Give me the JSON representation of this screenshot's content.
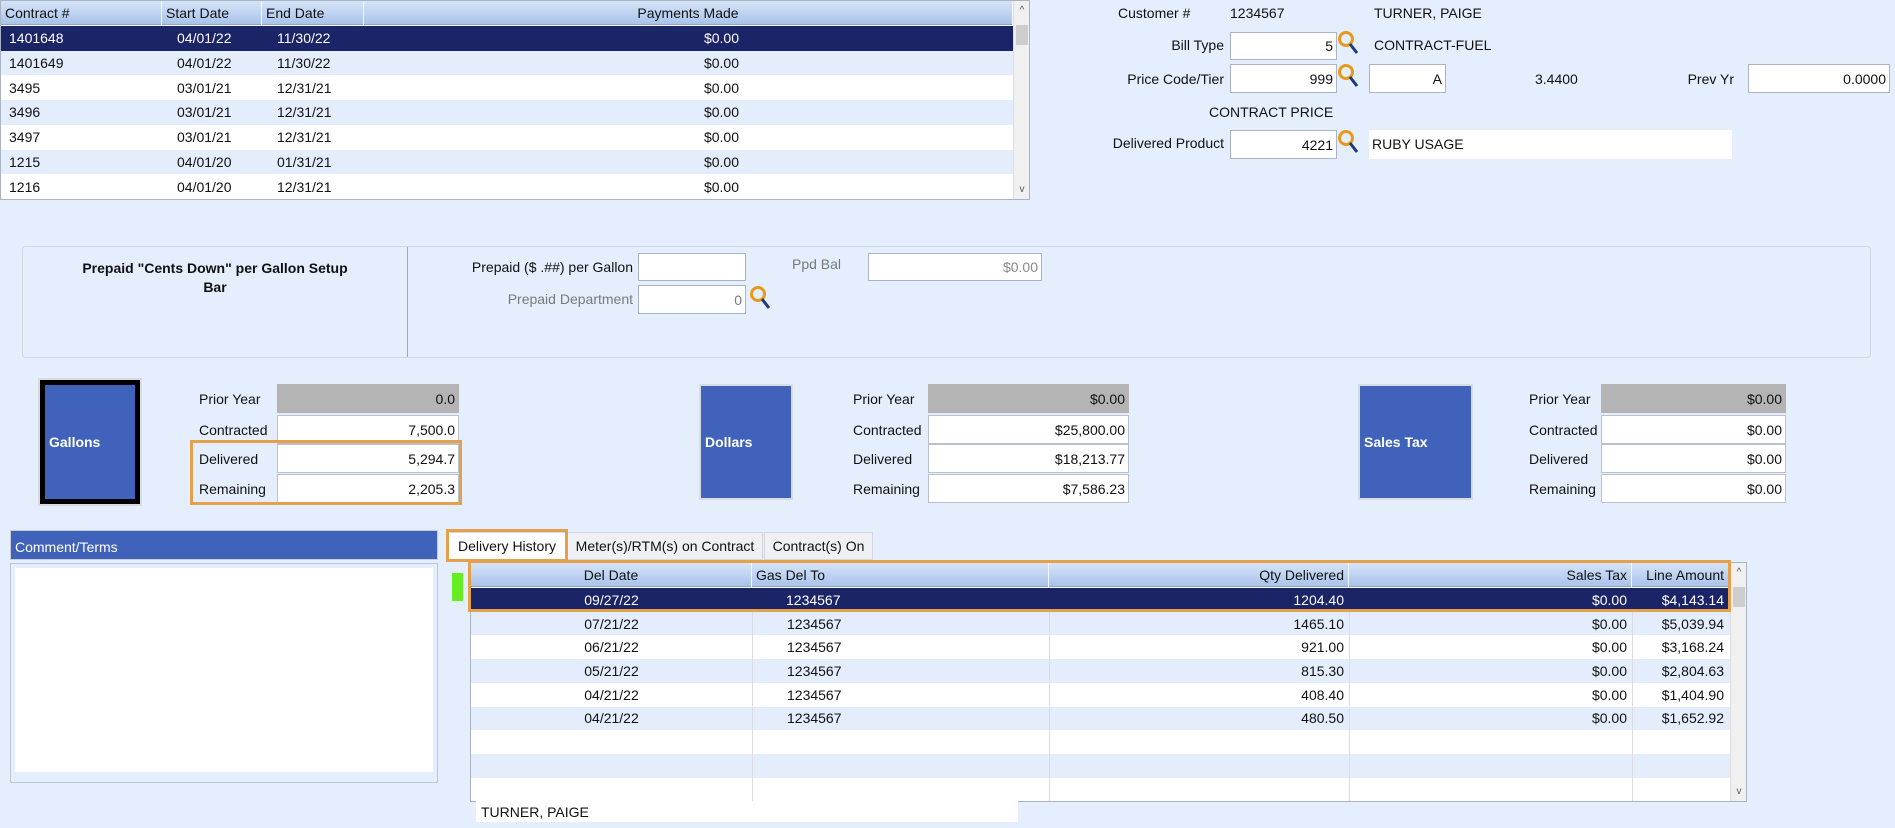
{
  "contracts": {
    "columns": [
      "Contract #",
      "Start Date",
      "End Date",
      "Payments Made"
    ],
    "rows": [
      [
        "1401648",
        "04/01/22",
        "11/30/22",
        "$0.00"
      ],
      [
        "1401649",
        "04/01/22",
        "11/30/22",
        "$0.00"
      ],
      [
        "3495",
        "03/01/21",
        "12/31/21",
        "$0.00"
      ],
      [
        "3496",
        "03/01/21",
        "12/31/21",
        "$0.00"
      ],
      [
        "3497",
        "03/01/21",
        "12/31/21",
        "$0.00"
      ],
      [
        "1215",
        "04/01/20",
        "01/31/21",
        "$0.00"
      ],
      [
        "1216",
        "04/01/20",
        "12/31/21",
        "$0.00"
      ]
    ],
    "selected_index": 0
  },
  "customer": {
    "customer_label": "Customer #",
    "customer_number": "1234567",
    "customer_name": "TURNER, PAIGE",
    "bill_type_label": "Bill Type",
    "bill_type_value": "5",
    "bill_type_desc": "CONTRACT-FUEL",
    "price_code_label": "Price Code/Tier",
    "price_code_value": "999",
    "tier_value": "A",
    "price": "3.4400",
    "prev_yr_label": "Prev Yr",
    "prev_yr_value": "0.0000",
    "price_desc": "CONTRACT PRICE",
    "delivered_product_label": "Delivered Product",
    "delivered_product_value": "4221",
    "delivered_product_desc": "RUBY USAGE"
  },
  "prepaid": {
    "title_line1": "Prepaid \"Cents Down\" per Gallon Setup",
    "title_line2": "Bar",
    "per_gallon_label": "Prepaid ($ .##) per Gallon",
    "per_gallon_value": "",
    "department_label": "Prepaid Department",
    "department_value": "0",
    "ppd_bal_label": "Ppd Bal",
    "ppd_bal_value": "$0.00"
  },
  "stats": {
    "row_labels": [
      "Prior Year",
      "Contracted",
      "Delivered",
      "Remaining"
    ],
    "gallons": {
      "button": "Gallons",
      "values": [
        "0.0",
        "7,500.0",
        "5,294.7",
        "2,205.3"
      ]
    },
    "dollars": {
      "button": "Dollars",
      "values": [
        "$0.00",
        "$25,800.00",
        "$18,213.77",
        "$7,586.23"
      ]
    },
    "sales_tax": {
      "button": "Sales Tax",
      "values": [
        "$0.00",
        "$0.00",
        "$0.00",
        "$0.00"
      ]
    }
  },
  "comments": {
    "header": "Comment/Terms",
    "text": ""
  },
  "tabs": [
    "Delivery History",
    "Meter(s)/RTM(s) on Contract",
    "Contract(s) On"
  ],
  "delivery": {
    "columns": [
      "Del Date",
      "Gas Del To",
      "Qty Delivered",
      "Sales Tax",
      "Line Amount"
    ],
    "rows": [
      [
        "09/27/22",
        "1234567",
        "1204.40",
        "$0.00",
        "$4,143.14"
      ],
      [
        "07/21/22",
        "1234567",
        "1465.10",
        "$0.00",
        "$5,039.94"
      ],
      [
        "06/21/22",
        "1234567",
        "921.00",
        "$0.00",
        "$3,168.24"
      ],
      [
        "05/21/22",
        "1234567",
        "815.30",
        "$0.00",
        "$2,804.63"
      ],
      [
        "04/21/22",
        "1234567",
        "408.40",
        "$0.00",
        "$1,404.90"
      ],
      [
        "04/21/22",
        "1234567",
        "480.50",
        "$0.00",
        "$1,652.92"
      ]
    ],
    "empty_rows": 3,
    "footer_name": "TURNER, PAIGE"
  },
  "colors": {
    "selected_row": "#1a2466",
    "highlight": "#e4a04a",
    "button_blue": "#4062bb",
    "indicator": "#66ee22"
  }
}
